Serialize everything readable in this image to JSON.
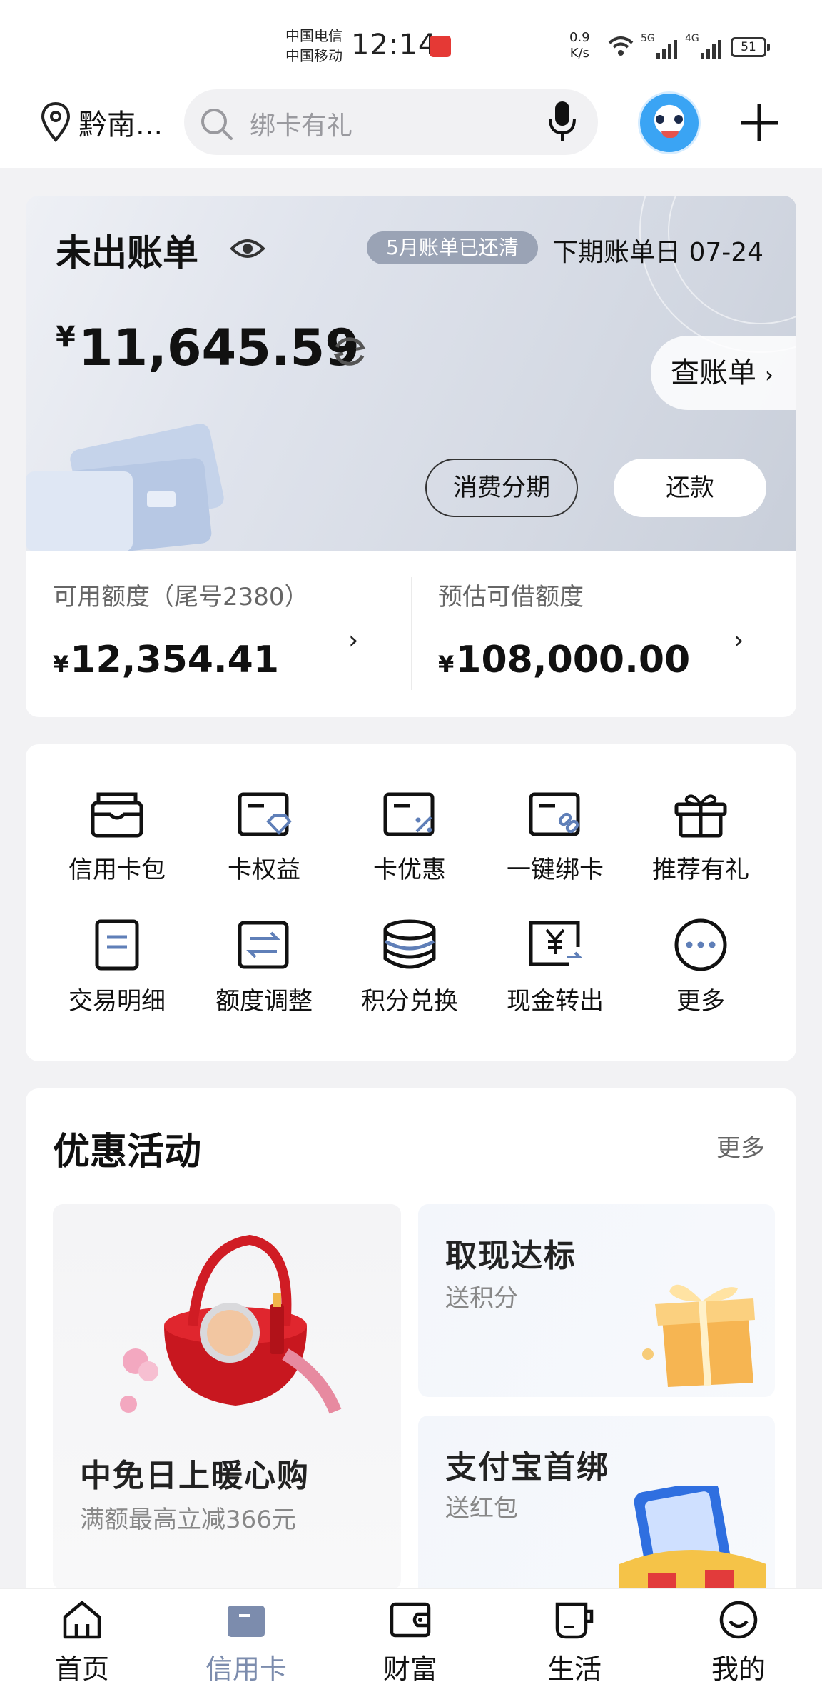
{
  "status_bar": {
    "carrier1": "中国电信",
    "carrier2": "中国移动",
    "time": "12:14",
    "net_speed_value": "0.9",
    "net_speed_unit": "K/s",
    "sig1_label": "5G",
    "sig2_label": "4G",
    "battery": "51"
  },
  "header": {
    "location": "黔南...",
    "search_placeholder": "绑卡有礼"
  },
  "bill": {
    "title": "未出账单",
    "paid_badge": "5月账单已还清",
    "next_due_label": "下期账单日 07-24",
    "currency": "¥",
    "amount": "11,645.59",
    "view_bill": "查账单",
    "installment": "消费分期",
    "repay": "还款"
  },
  "limits": {
    "available_label": "可用额度（尾号2380）",
    "available_value": "12,354.41",
    "loan_label": "预估可借额度",
    "loan_value": "108,000.00",
    "currency": "¥"
  },
  "grid": [
    {
      "label": "信用卡包",
      "icon": "card-wallet-icon"
    },
    {
      "label": "卡权益",
      "icon": "card-benefit-icon"
    },
    {
      "label": "卡优惠",
      "icon": "card-discount-icon"
    },
    {
      "label": "一键绑卡",
      "icon": "card-link-icon"
    },
    {
      "label": "推荐有礼",
      "icon": "gift-icon"
    },
    {
      "label": "交易明细",
      "icon": "document-icon"
    },
    {
      "label": "额度调整",
      "icon": "swap-icon"
    },
    {
      "label": "积分兑换",
      "icon": "coins-icon"
    },
    {
      "label": "现金转出",
      "icon": "cash-out-icon"
    },
    {
      "label": "更多",
      "icon": "more-icon"
    }
  ],
  "promotions": {
    "title": "优惠活动",
    "more": "更多",
    "big": {
      "title": "中免日上暖心购",
      "subtitle": "满额最高立减366元"
    },
    "items": [
      {
        "title": "取现达标",
        "subtitle": "送积分"
      },
      {
        "title": "支付宝首绑",
        "subtitle": "送红包"
      }
    ]
  },
  "tabbar": {
    "items": [
      "首页",
      "信用卡",
      "财富",
      "生活",
      "我的"
    ],
    "active_index": 1
  },
  "colors": {
    "active_tab": "#7c8cad",
    "badge": "#9aa3b5"
  }
}
